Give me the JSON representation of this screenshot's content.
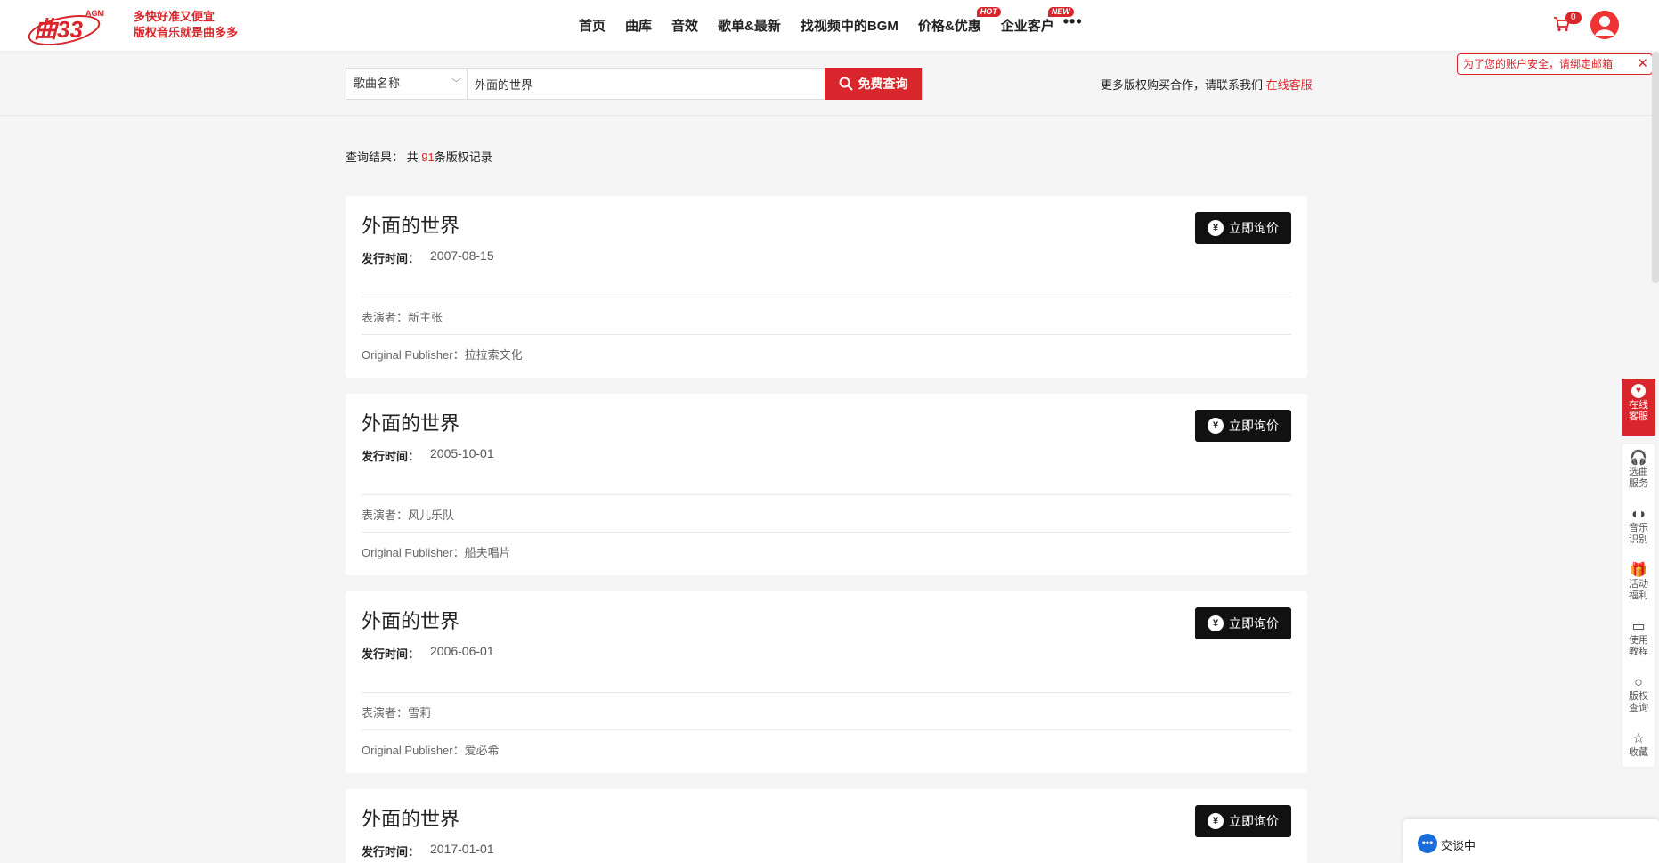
{
  "header": {
    "logo_text": "曲33",
    "logo_sub": "AGM",
    "slogan_line1": "多快好准又便宜",
    "slogan_line2": "版权音乐就是曲多多",
    "nav": [
      {
        "label": "首页"
      },
      {
        "label": "曲库"
      },
      {
        "label": "音效"
      },
      {
        "label": "歌单&最新"
      },
      {
        "label": "找视频中的BGM"
      },
      {
        "label": "价格&优惠",
        "badge": "HOT"
      },
      {
        "label": "企业客户",
        "badge": "NEW"
      }
    ],
    "nav_more": "•••",
    "cart_count": "0"
  },
  "search": {
    "select_value": "歌曲名称",
    "input_value": "外面的世界",
    "button_label": "免费查询",
    "promo_text": "更多版权购买合作，请联系我们",
    "promo_link": "在线客服"
  },
  "security_notice": {
    "text": "为了您的账户安全，请",
    "link": "绑定邮箱",
    "close": "✕"
  },
  "results": {
    "label_prefix": "查询结果：  共",
    "count": "91",
    "label_suffix": "条版权记录",
    "date_label": "发行时间：",
    "performer_label": "表演者：",
    "publisher_label": "Original Publisher：",
    "inquire_label": "立即询价",
    "items": [
      {
        "title": "外面的世界",
        "date": "2007-08-15",
        "performer": "新主张",
        "publisher": "拉拉索文化"
      },
      {
        "title": "外面的世界",
        "date": "2005-10-01",
        "performer": "风儿乐队",
        "publisher": "船夫唱片"
      },
      {
        "title": "外面的世界",
        "date": "2006-06-01",
        "performer": "雪莉",
        "publisher": "爱必希"
      },
      {
        "title": "外面的世界",
        "date": "2017-01-01",
        "performer": "",
        "publisher": ""
      }
    ]
  },
  "sidebar": {
    "online": "在线\n客服",
    "items": [
      {
        "label": "选曲\n服务",
        "icon": "headset-icon"
      },
      {
        "label": "音乐\n识别",
        "icon": "headphones-icon"
      },
      {
        "label": "活动\n福利",
        "icon": "gift-icon"
      },
      {
        "label": "使用\n教程",
        "icon": "tutorial-icon"
      },
      {
        "label": "版权\n查询",
        "icon": "search-icon"
      },
      {
        "label": "收藏",
        "icon": "star-icon"
      }
    ]
  },
  "chat": {
    "label": "交谈中"
  },
  "colors": {
    "brand": "#d9252c",
    "button_dark": "#111111"
  }
}
